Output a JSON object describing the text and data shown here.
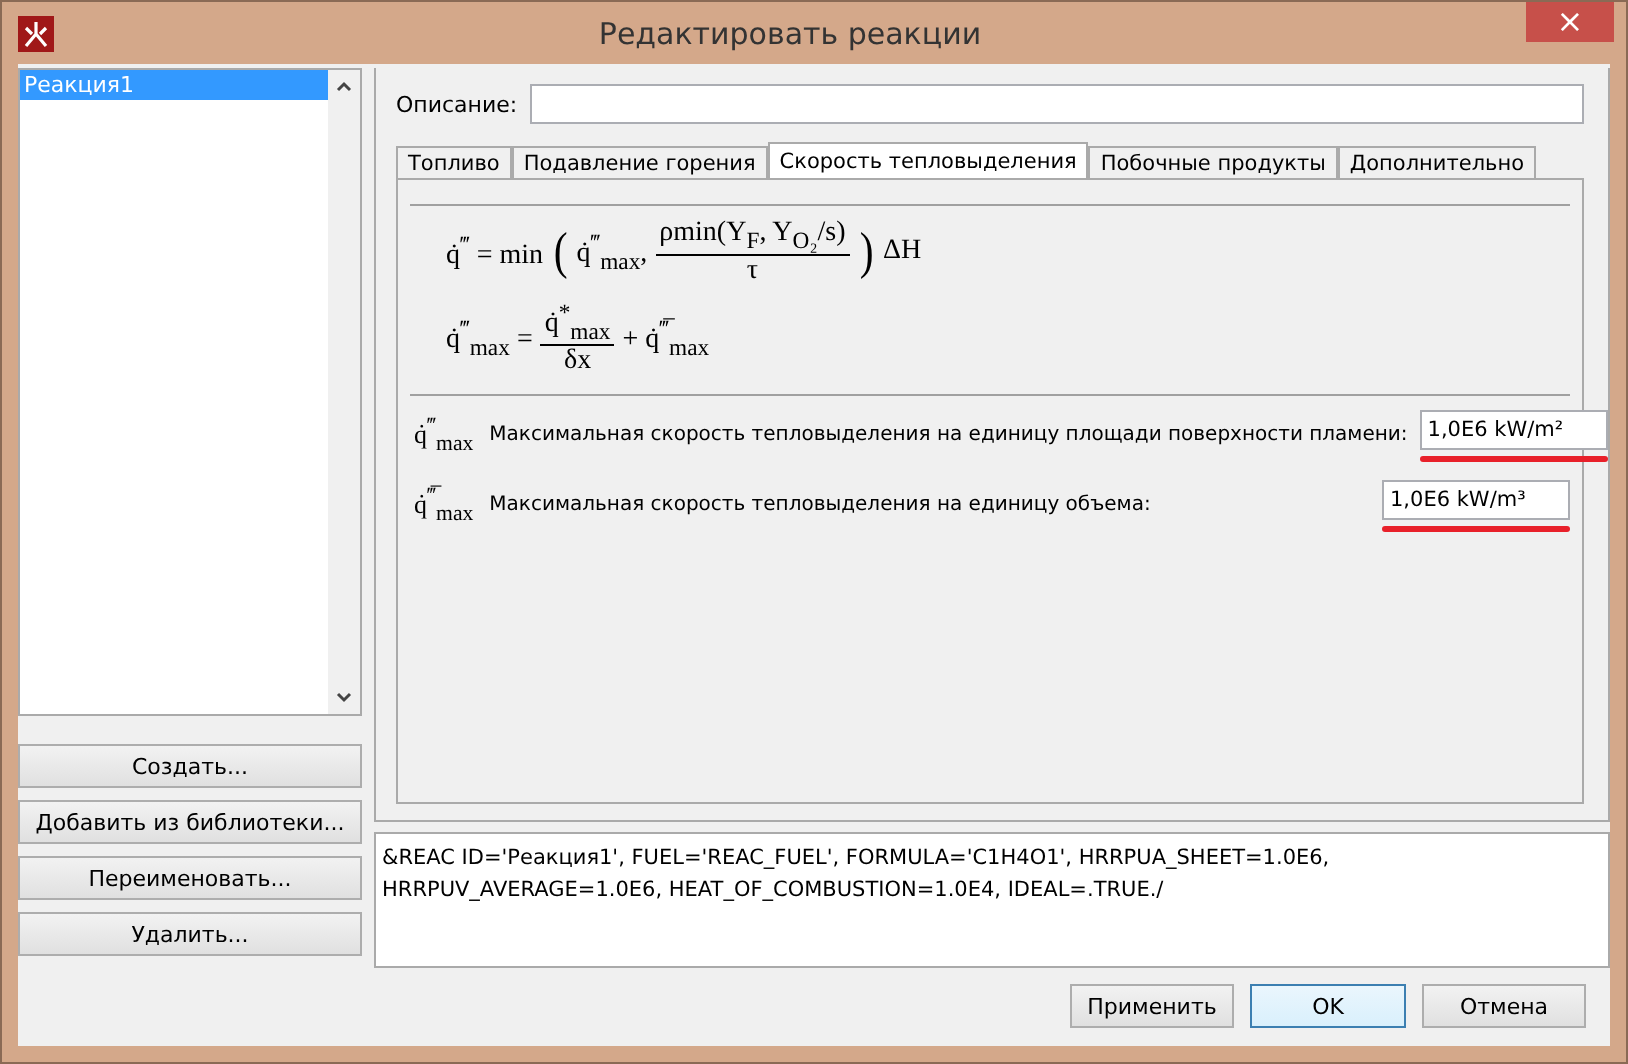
{
  "window": {
    "title": "Редактировать реакции",
    "close": "×"
  },
  "reactions": [
    {
      "name": "Реакция1",
      "selected": true
    }
  ],
  "side_buttons": [
    "Создать...",
    "Добавить из библиотеки...",
    "Переименовать...",
    "Удалить..."
  ],
  "description": {
    "label": "Описание:"
  },
  "tabs": [
    {
      "label": "Топливо",
      "selected": false
    },
    {
      "label": "Подавление горения",
      "selected": false
    },
    {
      "label": "Скорость тепловыделения",
      "selected": true
    },
    {
      "label": "Побочные продукты",
      "selected": false
    },
    {
      "label": "Дополнительно",
      "selected": false
    }
  ],
  "formulas": [
    [
      {
        "kind": "text",
        "text": "q̇$^{‴}$ = min"
      },
      {
        "kind": "paren",
        "text": "("
      },
      {
        "kind": "text",
        "text": "q̇$^{‴}$$_{max}$,"
      },
      {
        "kind": "frac",
        "num": "ρmin(Y$_{F}$, Y$_{O₂}$/s)",
        "den": "τ"
      },
      {
        "kind": "paren",
        "text": ")"
      },
      {
        "kind": "text",
        "text": "ΔH"
      }
    ],
    [
      {
        "kind": "text",
        "text": "q̇$^{‴}$$_{max}$ ="
      },
      {
        "kind": "frac",
        "num": "q̇$^{*}$$_{max}$",
        "den": "δx"
      },
      {
        "kind": "text",
        "text": "+ q̇$^{‴̅}$$_{max}$"
      }
    ]
  ],
  "parameters": [
    {
      "symbol": "q̇$^{‴}$$_{max}$",
      "label": "Максимальная скорость тепловыделения на единицу площади поверхности пламени:",
      "value": "1,0E6 kW/m²",
      "underlined": true
    },
    {
      "symbol": "q̇$^{‴̅}$$_{max}$",
      "label": "Максимальная скорость тепловыделения на единицу объема:",
      "value": "1,0E6 kW/m³",
      "underlined": true
    }
  ],
  "output": "&REAC ID='Реакция1', FUEL='REAC_FUEL', FORMULA='C1H4O1', HRRPUA_SHEET=1.0E6, HRRPUV_AVERAGE=1.0E6, HEAT_OF_COMBUSTION=1.0E4, IDEAL=.TRUE./",
  "buttons": [
    {
      "label": "Применить",
      "default": false
    },
    {
      "label": "OK",
      "default": true
    },
    {
      "label": "Отмена",
      "default": false
    }
  ]
}
